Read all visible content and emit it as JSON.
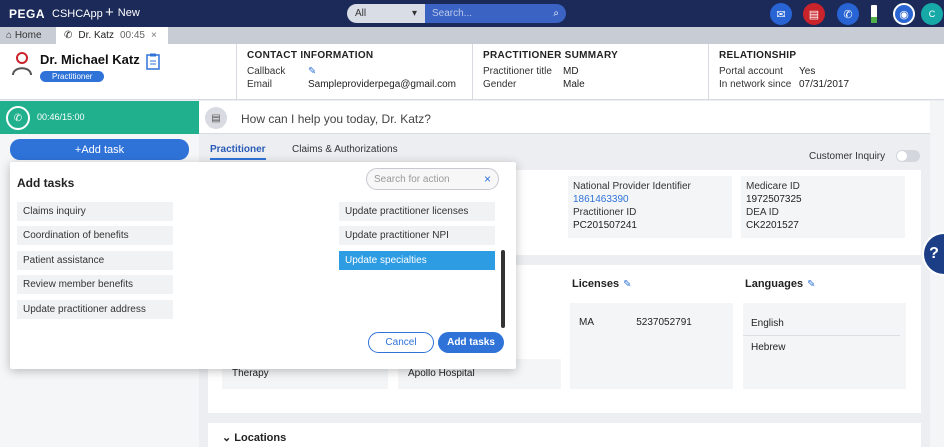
{
  "topbar": {
    "brand": "PEGA",
    "app_name": "CSHCApp",
    "new_label": "New",
    "search_scope": "All",
    "search_placeholder": "Search...",
    "avatar_initial": "C"
  },
  "tabs": {
    "home_label": "Home",
    "active_tab_label": "Dr. Katz",
    "active_tab_timer": "00:45"
  },
  "header": {
    "name": "Dr. Michael Katz",
    "tag": "Practitioner",
    "contact": {
      "title": "CONTACT INFORMATION",
      "rows": [
        {
          "k": "Callback",
          "v": ""
        },
        {
          "k": "Email",
          "v": "Sampleproviderpega@gmail.com"
        }
      ]
    },
    "summary": {
      "title": "PRACTITIONER SUMMARY",
      "rows": [
        {
          "k": "Practitioner title",
          "v": "MD"
        },
        {
          "k": "Gender",
          "v": "Male"
        }
      ]
    },
    "relationship": {
      "title": "RELATIONSHIP",
      "rows": [
        {
          "k": "Portal account",
          "v": "Yes"
        },
        {
          "k": "In network since",
          "v": "07/31/2017"
        }
      ]
    }
  },
  "left": {
    "timer": "00:46/15:00",
    "add_task_label": "Add task"
  },
  "main": {
    "prompt": "How can I help you today, Dr. Katz?",
    "tab_practitioner": "Practitioner",
    "tab_claims": "Claims & Authorizations",
    "customer_inquiry": "Customer Inquiry",
    "npi_label": "National Provider Identifier",
    "npi_value": "1861463390",
    "pid_label": "Practitioner ID",
    "pid_value": "PC201507241",
    "medicare_label": "Medicare ID",
    "medicare_value": "1972507325",
    "dea_label": "DEA ID",
    "dea_value": "CK2201527",
    "licenses_title": "Licenses",
    "license_state": "MA",
    "license_number": "5237052791",
    "languages_title": "Languages",
    "languages": [
      "English",
      "Hebrew"
    ],
    "therapy_text": "Therapy",
    "hospital_text": "Apollo Hospital",
    "locations_title": "Locations"
  },
  "modal": {
    "title": "Add tasks",
    "search_placeholder": "Search for action",
    "left_items": [
      "Claims inquiry",
      "Coordination of benefits",
      "Patient assistance",
      "Review member benefits",
      "Update practitioner address"
    ],
    "right_items": [
      "Update practitioner licenses",
      "Update practitioner NPI",
      "Update specialties"
    ],
    "selected_item": "Update specialties",
    "cancel_label": "Cancel",
    "add_label": "Add tasks"
  },
  "colors": {
    "topbar": "#1b2a58",
    "accent": "#2f73d9",
    "timer_bg": "#20b08d",
    "selected": "#2e9ce2"
  },
  "icons": [
    "home-icon",
    "phone-icon",
    "close-icon",
    "search-icon",
    "chevron-down-icon",
    "mail-icon",
    "chat-icon",
    "battery-icon",
    "bot-icon",
    "person-icon",
    "clipboard-icon",
    "pencil-icon",
    "help-icon"
  ]
}
